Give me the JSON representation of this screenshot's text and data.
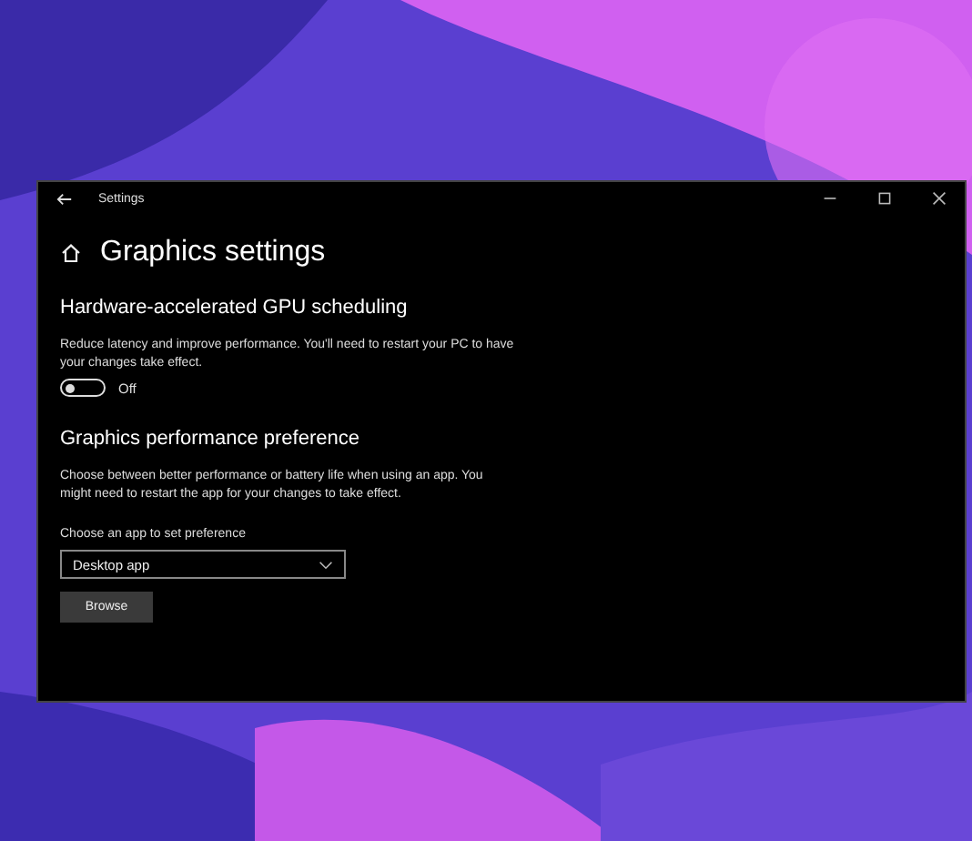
{
  "window": {
    "title": "Settings"
  },
  "page": {
    "title": "Graphics settings"
  },
  "gpu_scheduling": {
    "heading": "Hardware-accelerated GPU scheduling",
    "description": "Reduce latency and improve performance. You'll need to restart your PC to have your changes take effect.",
    "toggle": {
      "on": false,
      "label": "Off"
    }
  },
  "performance": {
    "heading": "Graphics performance preference",
    "description": "Choose between better performance or battery life when using an app. You might need to restart the app for your changes to take effect.",
    "dropdown_label": "Choose an app to set preference",
    "dropdown": {
      "value": "Desktop app"
    },
    "button": "Browse"
  }
}
